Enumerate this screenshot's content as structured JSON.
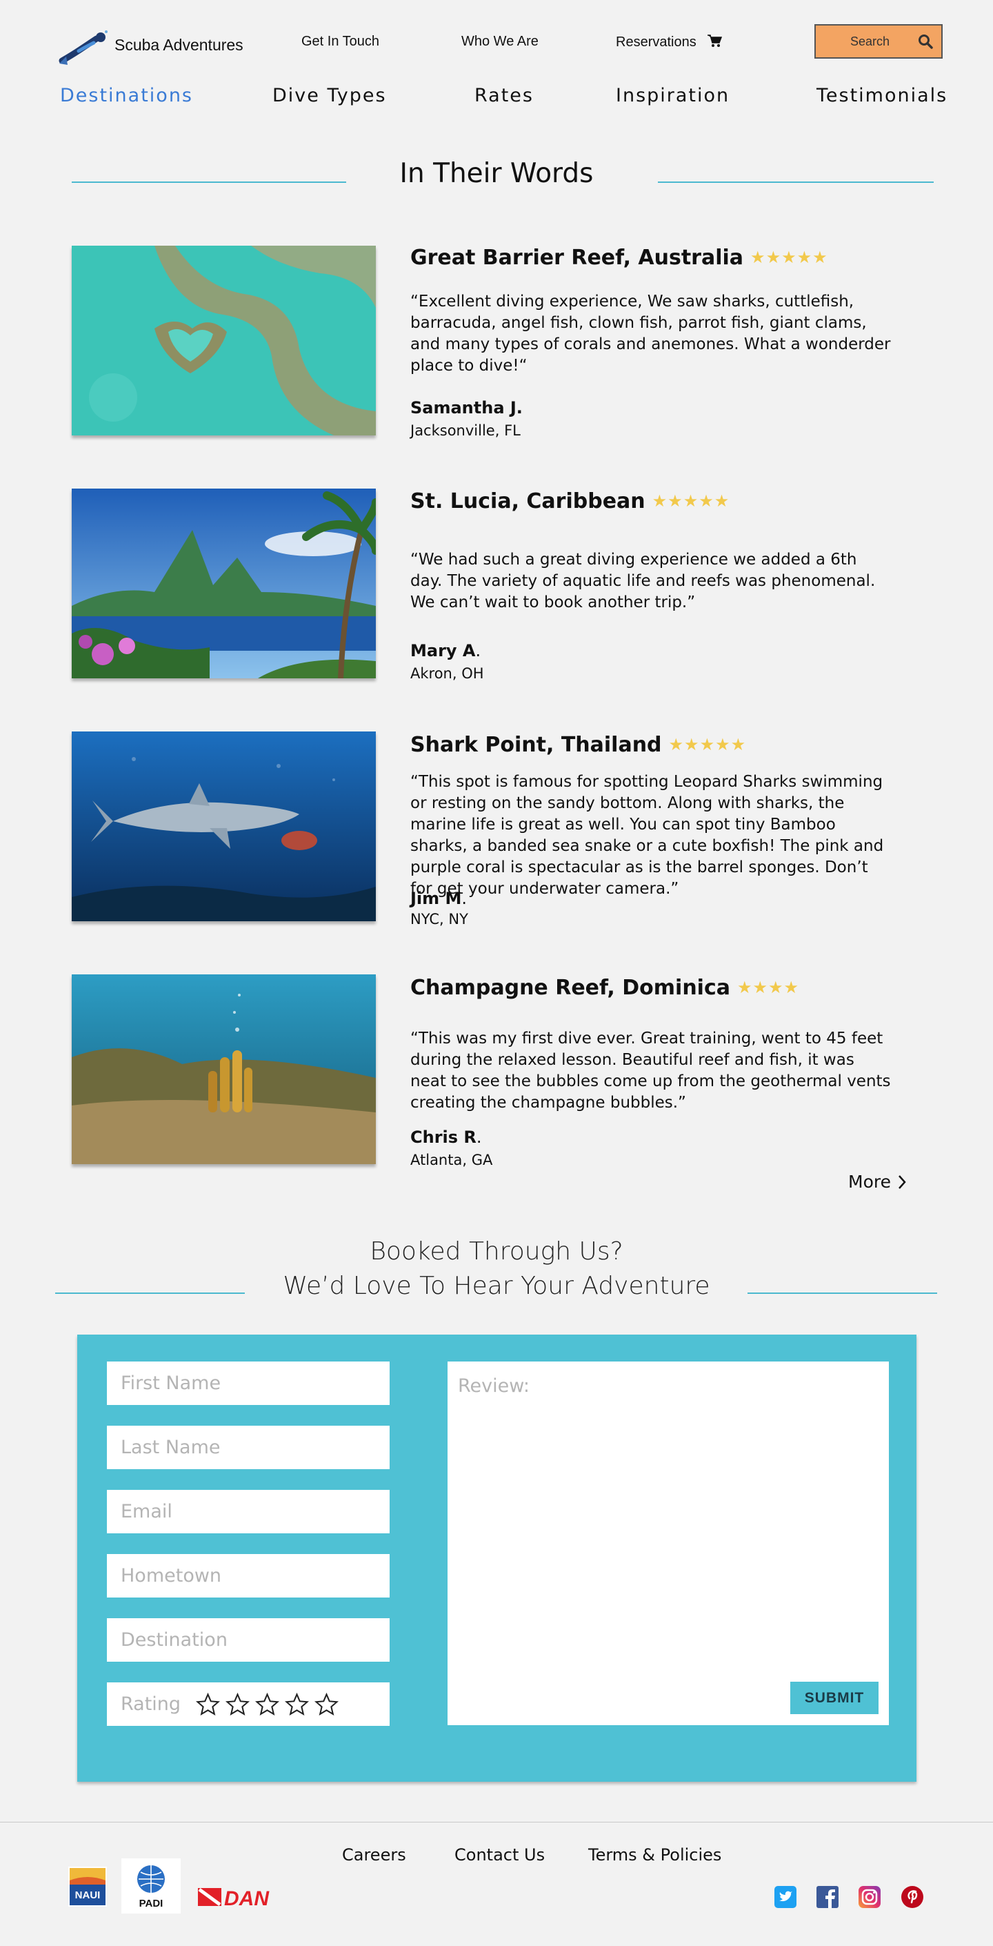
{
  "header": {
    "logo_text": "Scuba Adventures",
    "utility_links": [
      "Get In Touch",
      "Who We Are",
      "Reservations"
    ],
    "search_label": "Search"
  },
  "nav": {
    "items": [
      "Destinations",
      "Dive Types",
      "Rates",
      "Inspiration",
      "Testimonials"
    ],
    "active": "Destinations",
    "active_color": "#3a7bd5"
  },
  "testimonials": {
    "title": "In Their Words",
    "items": [
      {
        "place": "Great Barrier Reef, Australia",
        "rating": 5,
        "quote": "“Excellent diving experience, We saw sharks, cuttlefish, barracuda, angel fish, clown fish, parrot fish, giant clams, and many types of corals and anemones. What a wonderder place to dive!“",
        "name": "Samantha J.",
        "name_suffix": "",
        "city": "Jacksonville, FL"
      },
      {
        "place": "St. Lucia, Caribbean",
        "rating": 5,
        "quote": "“We had such a great diving experience we added a 6th day. The variety of aquatic life and reefs was phenomenal. We can’t wait to book another trip.”",
        "name": "Mary A",
        "name_suffix": ".",
        "city": "Akron, OH"
      },
      {
        "place": "Shark Point, Thailand",
        "rating": 5,
        "quote": "“This spot is famous for spotting Leopard Sharks swimming or resting on the sandy bottom. Along with sharks, the marine life is great as well. You can spot tiny Bamboo sharks, a banded sea snake or a cute boxfish! The pink and purple coral is spectacular as is the barrel sponges. Don’t for get your underwater camera.”",
        "name": "Jim M",
        "name_suffix": ".",
        "city": "NYC, NY"
      },
      {
        "place": "Champagne Reef, Dominica",
        "rating": 4,
        "quote": "“This was my first dive ever. Great training, went to 45 feet during the relaxed lesson. Beautiful reef and fish, it was neat to see the bubbles come up from the geothermal vents creating the champagne bubbles.”",
        "name": "Chris R",
        "name_suffix": ".",
        "city": "Atlanta, GA"
      }
    ],
    "more_label": "More"
  },
  "booking": {
    "line1": "Booked Through Us?",
    "line2": "We’d Love To Hear Your Adventure",
    "placeholders": {
      "first_name": "First Name",
      "last_name": "Last Name",
      "email": "Email",
      "hometown": "Hometown",
      "destination": "Destination",
      "rating": "Rating",
      "review": "Review:"
    },
    "rating_star_count": 5,
    "submit_label": "SUBMIT",
    "panel_color": "#4fc1d4"
  },
  "footer": {
    "links": [
      "Careers",
      "Contact Us",
      "Terms & Policies"
    ],
    "brands": [
      "NAUI",
      "PADI",
      "DAN"
    ],
    "social_icons": [
      "twitter-icon",
      "facebook-icon",
      "instagram-icon",
      "pinterest-icon"
    ]
  }
}
